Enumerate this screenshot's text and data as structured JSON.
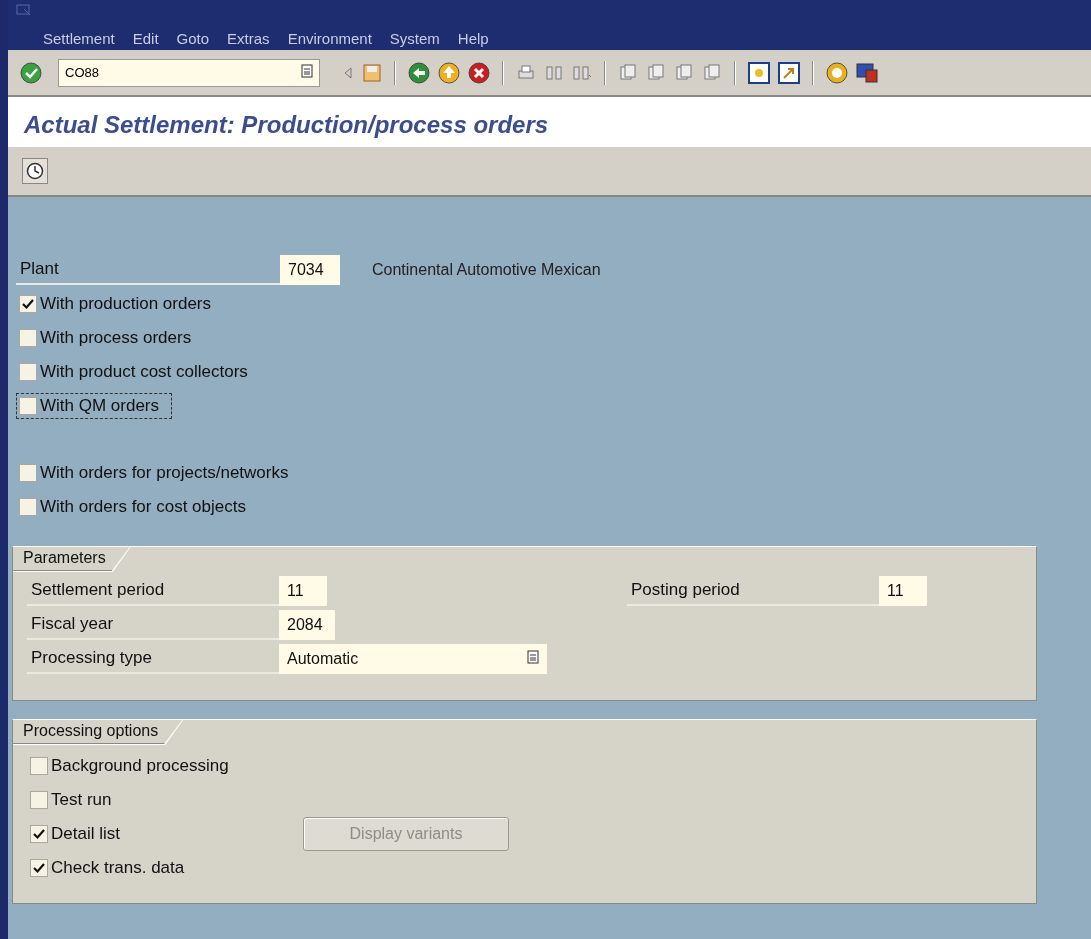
{
  "menu": [
    "Settlement",
    "Edit",
    "Goto",
    "Extras",
    "Environment",
    "System",
    "Help"
  ],
  "command_field": {
    "value": "CO88"
  },
  "title": "Actual Settlement: Production/process orders",
  "plant": {
    "label": "Plant",
    "value": "7034",
    "description": "Continental Automotive Mexican"
  },
  "order_options": [
    {
      "label": "With production orders",
      "checked": true,
      "focused": false
    },
    {
      "label": "With process orders",
      "checked": false,
      "focused": false
    },
    {
      "label": "With product cost collectors",
      "checked": false,
      "focused": false
    },
    {
      "label": "With QM orders",
      "checked": false,
      "focused": true
    }
  ],
  "more_order_options": [
    {
      "label": "With orders for projects/networks",
      "checked": false,
      "focused": false
    },
    {
      "label": "With orders for cost objects",
      "checked": false,
      "focused": false
    }
  ],
  "parameters": {
    "title": "Parameters",
    "rows": [
      [
        {
          "label": "Settlement period",
          "value": "11",
          "kind": "text"
        },
        {
          "label": "Posting period",
          "value": "11",
          "kind": "text"
        }
      ],
      [
        {
          "label": "Fiscal year",
          "value": "2084",
          "kind": "text"
        }
      ],
      [
        {
          "label": "Processing type",
          "value": "Automatic",
          "kind": "dropdown"
        }
      ]
    ]
  },
  "processing_options": {
    "title": "Processing options",
    "options": [
      {
        "label": "Background processing",
        "checked": false
      },
      {
        "label": "Test run",
        "checked": false
      },
      {
        "label": "Detail list",
        "checked": true,
        "button": {
          "label": "Display variants",
          "disabled": true
        }
      },
      {
        "label": "Check trans. data",
        "checked": true
      }
    ]
  }
}
